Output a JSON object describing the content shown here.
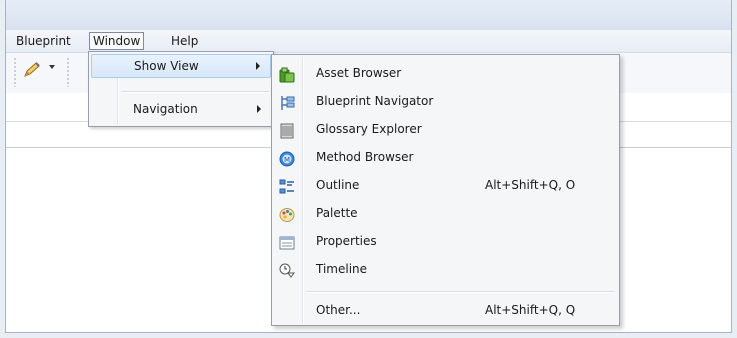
{
  "menubar": {
    "items": [
      "Blueprint",
      "Window",
      "Help"
    ]
  },
  "window_menu": {
    "items": [
      {
        "label": "Show View"
      },
      {
        "label": "Navigation"
      }
    ]
  },
  "show_view_menu": {
    "items": [
      {
        "label": "Asset Browser",
        "icon": "asset-browser-icon",
        "shortcut": ""
      },
      {
        "label": "Blueprint Navigator",
        "icon": "blueprint-navigator-icon",
        "shortcut": ""
      },
      {
        "label": "Glossary Explorer",
        "icon": "glossary-explorer-icon",
        "shortcut": ""
      },
      {
        "label": "Method Browser",
        "icon": "method-browser-icon",
        "shortcut": ""
      },
      {
        "label": "Outline",
        "icon": "outline-icon",
        "shortcut": "Alt+Shift+Q, O"
      },
      {
        "label": "Palette",
        "icon": "palette-icon",
        "shortcut": ""
      },
      {
        "label": "Properties",
        "icon": "properties-icon",
        "shortcut": ""
      },
      {
        "label": "Timeline",
        "icon": "timeline-icon",
        "shortcut": ""
      },
      {
        "label": "Other...",
        "icon": "",
        "shortcut": "Alt+Shift+Q, Q"
      }
    ]
  },
  "colors": {
    "menu_highlight": "#d7e8f9",
    "menu_highlight_border": "#a8cbee",
    "menu_background": "#f5f6f8"
  }
}
